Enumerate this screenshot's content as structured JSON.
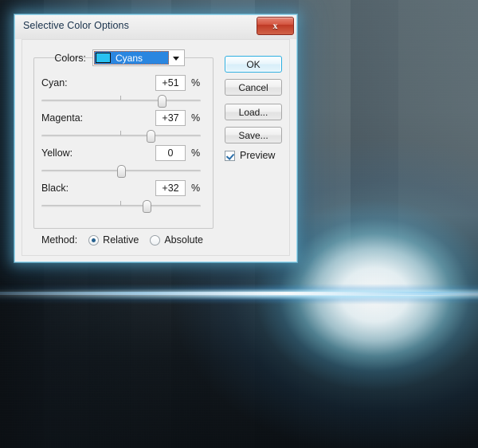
{
  "window": {
    "title": "Selective Color Options",
    "close_label": "x",
    "glow_color": "#6ecdf0"
  },
  "colors_field": {
    "label": "Colors:",
    "selected": "Cyans",
    "swatch_color": "#29c1f0",
    "highlight_color": "#2a86e0"
  },
  "sliders": [
    {
      "label": "Cyan:",
      "value": "+51",
      "unit": "%",
      "percent": 75.5
    },
    {
      "label": "Magenta:",
      "value": "+37",
      "unit": "%",
      "percent": 68.5
    },
    {
      "label": "Yellow:",
      "value": "0",
      "unit": "%",
      "percent": 50.0
    },
    {
      "label": "Black:",
      "value": "+32",
      "unit": "%",
      "percent": 66.0
    }
  ],
  "method": {
    "label": "Method:",
    "options": [
      {
        "label": "Relative",
        "selected": true
      },
      {
        "label": "Absolute",
        "selected": false
      }
    ]
  },
  "buttons": {
    "ok": "OK",
    "cancel": "Cancel",
    "load": "Load...",
    "save": "Save..."
  },
  "preview": {
    "label": "Preview",
    "checked": true
  }
}
